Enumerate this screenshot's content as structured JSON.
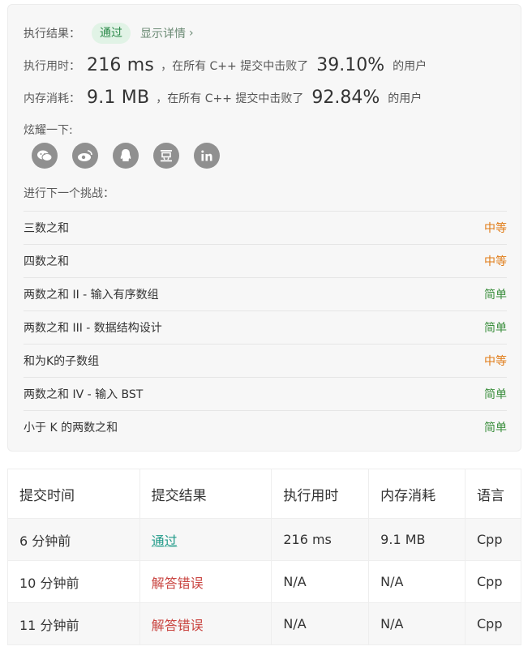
{
  "result": {
    "label": "执行结果：",
    "status": "通过",
    "detail_link": "显示详情",
    "chevron": "›"
  },
  "runtime": {
    "label": "执行用时：",
    "value": "216 ms",
    "middle": "，在所有 C++ 提交中击败了",
    "percent": "39.10%",
    "suffix": "的用户"
  },
  "memory": {
    "label": "内存消耗：",
    "value": "9.1 MB",
    "middle": "，在所有 C++ 提交中击败了",
    "percent": "92.84%",
    "suffix": "的用户"
  },
  "share": {
    "label": "炫耀一下:",
    "icons": [
      "wechat-icon",
      "weibo-icon",
      "qq-icon",
      "douban-icon",
      "linkedin-icon"
    ]
  },
  "challenge": {
    "label": "进行下一个挑战：",
    "items": [
      {
        "title": "三数之和",
        "difficulty": "中等"
      },
      {
        "title": "四数之和",
        "difficulty": "中等"
      },
      {
        "title": "两数之和 II - 输入有序数组",
        "difficulty": "简单"
      },
      {
        "title": "两数之和 III - 数据结构设计",
        "difficulty": "简单"
      },
      {
        "title": "和为K的子数组",
        "difficulty": "中等"
      },
      {
        "title": "两数之和 IV - 输入 BST",
        "difficulty": "简单"
      },
      {
        "title": "小于 K 的两数之和",
        "difficulty": "简单"
      }
    ]
  },
  "submissions": {
    "headers": [
      "提交时间",
      "提交结果",
      "执行用时",
      "内存消耗",
      "语言"
    ],
    "rows": [
      {
        "time": "6 分钟前",
        "result": "通过",
        "runtime": "216 ms",
        "memory": "9.1 MB",
        "lang": "Cpp"
      },
      {
        "time": "10 分钟前",
        "result": "解答错误",
        "runtime": "N/A",
        "memory": "N/A",
        "lang": "Cpp"
      },
      {
        "time": "11 分钟前",
        "result": "解答错误",
        "runtime": "N/A",
        "memory": "N/A",
        "lang": "Cpp"
      }
    ]
  },
  "colors": {
    "medium": "#e07b16",
    "easy": "#3a8e3c",
    "pass": "#1f9a88",
    "wrong": "#c94440"
  }
}
